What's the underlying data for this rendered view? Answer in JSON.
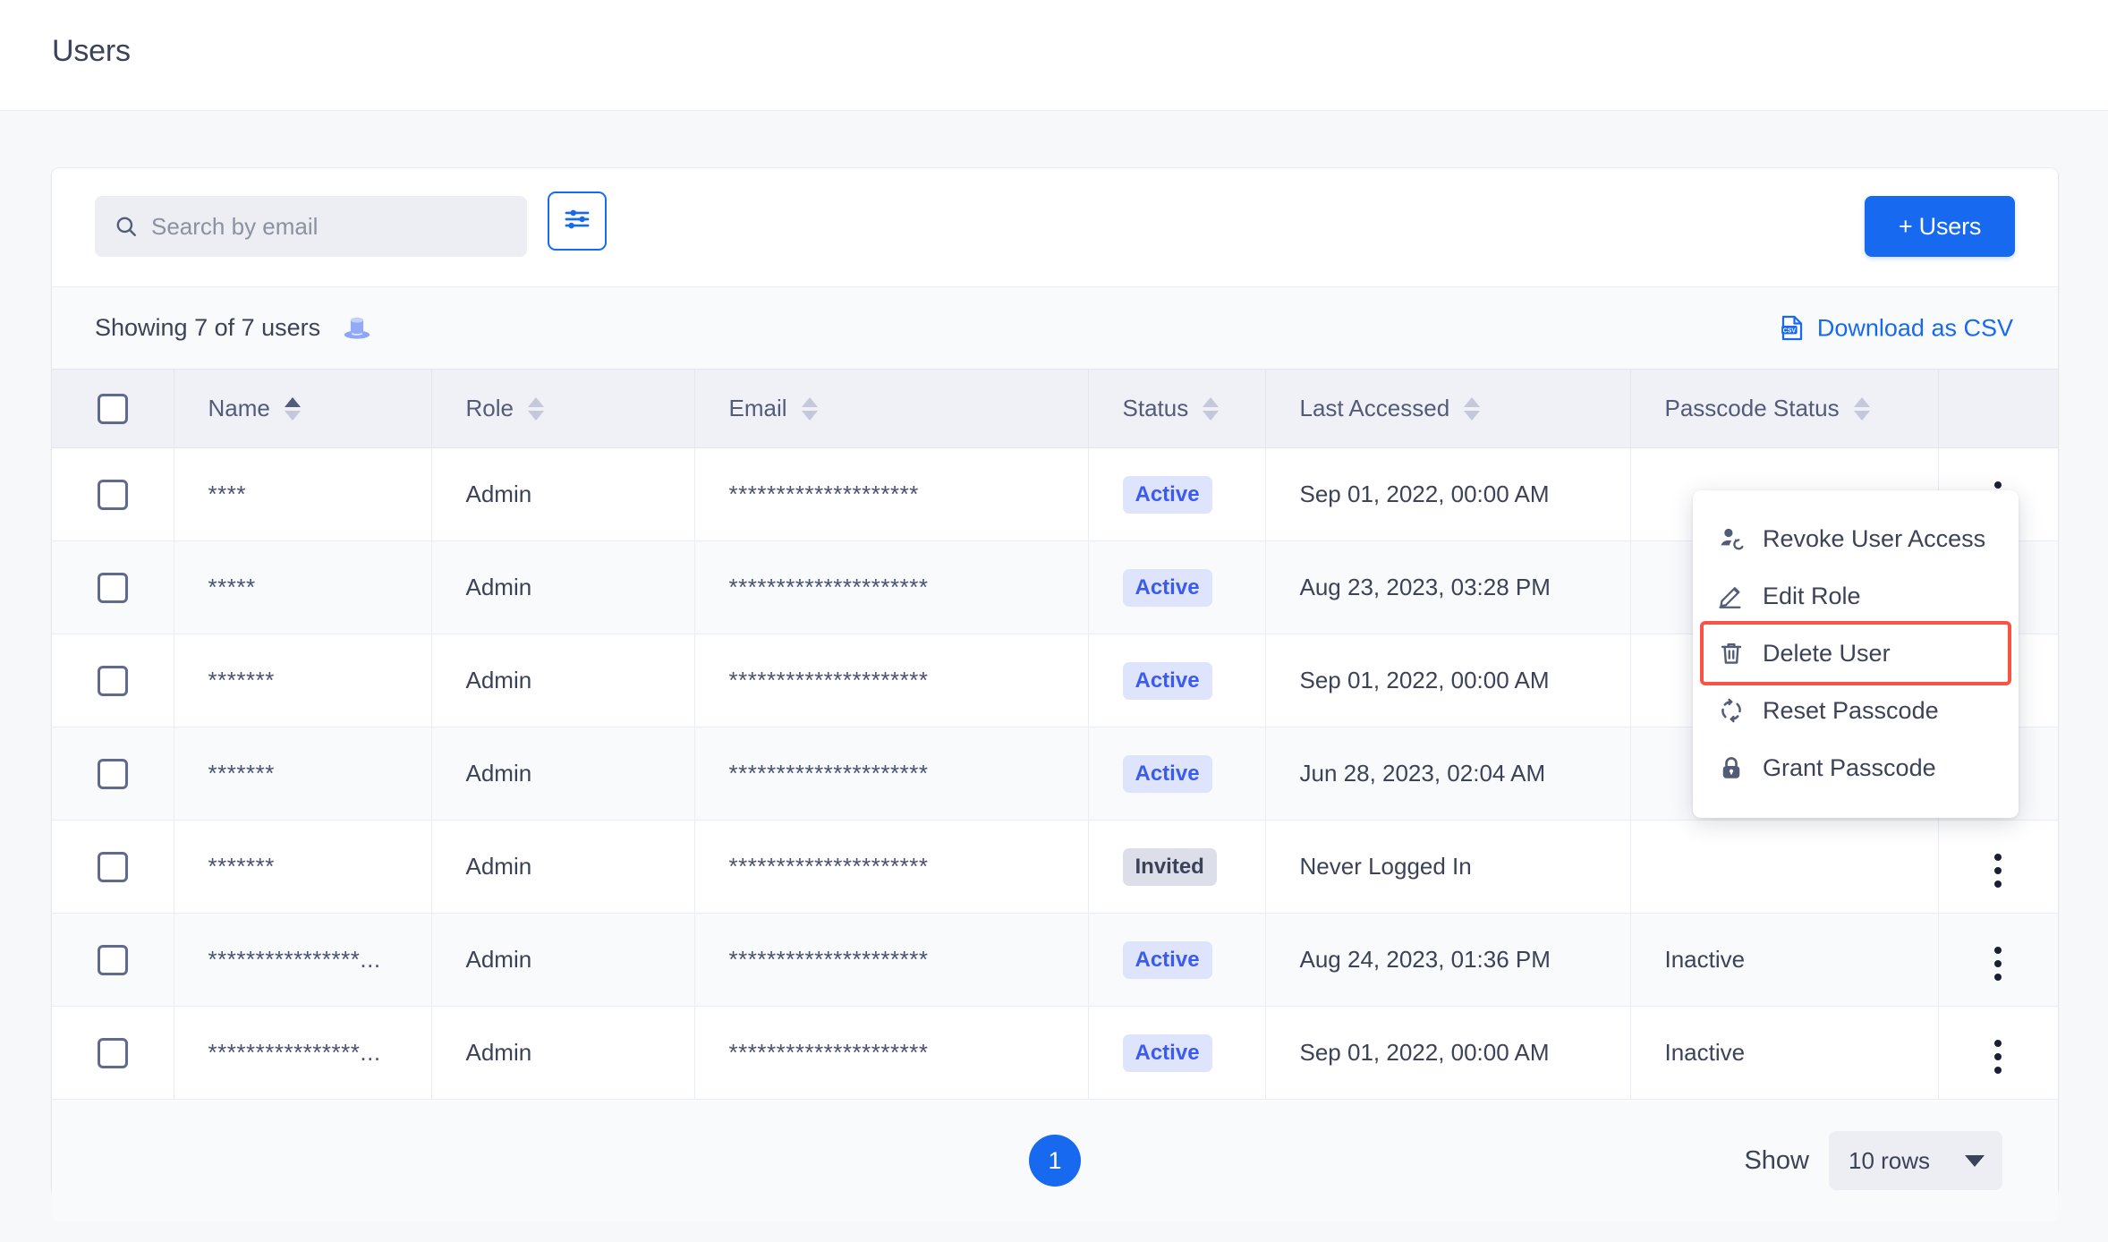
{
  "page": {
    "title": "Users"
  },
  "toolbar": {
    "search_placeholder": "Search by email",
    "search_value": "",
    "filter_icon": "sliders-icon",
    "add_users_label": "+ Users"
  },
  "summary": {
    "text": "Showing 7 of 7 users",
    "hat_icon": "top-hat-icon",
    "csv_label": "Download as CSV",
    "csv_icon": "csv-file-icon"
  },
  "table": {
    "columns": [
      {
        "key": "check",
        "label": ""
      },
      {
        "key": "name",
        "label": "Name",
        "sorted": true
      },
      {
        "key": "role",
        "label": "Role",
        "sorted": false
      },
      {
        "key": "email",
        "label": "Email",
        "sorted": false
      },
      {
        "key": "status",
        "label": "Status",
        "sorted": false
      },
      {
        "key": "last",
        "label": "Last Accessed",
        "sorted": false
      },
      {
        "key": "pass",
        "label": "Passcode Status",
        "sorted": false
      },
      {
        "key": "kebab",
        "label": ""
      }
    ],
    "rows": [
      {
        "name": "****",
        "role": "Admin",
        "email": "********************",
        "status": "Active",
        "status_type": "active",
        "last_accessed": "Sep 01, 2022, 00:00 AM",
        "passcode_status": ""
      },
      {
        "name": "*****",
        "role": "Admin",
        "email": "*********************",
        "status": "Active",
        "status_type": "active",
        "last_accessed": "Aug 23, 2023, 03:28 PM",
        "passcode_status": ""
      },
      {
        "name": "*******",
        "role": "Admin",
        "email": "*********************",
        "status": "Active",
        "status_type": "active",
        "last_accessed": "Sep 01, 2022, 00:00 AM",
        "passcode_status": ""
      },
      {
        "name": "*******",
        "role": "Admin",
        "email": "*********************",
        "status": "Active",
        "status_type": "active",
        "last_accessed": "Jun 28, 2023, 02:04 AM",
        "passcode_status": ""
      },
      {
        "name": "*******",
        "role": "Admin",
        "email": "*********************",
        "status": "Invited",
        "status_type": "invited",
        "last_accessed": "Never Logged In",
        "passcode_status": ""
      },
      {
        "name": "****************...",
        "role": "Admin",
        "email": "*********************",
        "status": "Active",
        "status_type": "active",
        "last_accessed": "Aug 24, 2023, 01:36 PM",
        "passcode_status": "Inactive"
      },
      {
        "name": "****************...",
        "role": "Admin",
        "email": "*********************",
        "status": "Active",
        "status_type": "active",
        "last_accessed": "Sep 01, 2022, 00:00 AM",
        "passcode_status": "Inactive"
      }
    ]
  },
  "footer": {
    "current_page": "1",
    "show_label": "Show",
    "rows_value": "10 rows"
  },
  "context_menu": {
    "items": [
      {
        "label": "Revoke User Access",
        "icon": "user-revoke-icon",
        "highlighted": false
      },
      {
        "label": "Edit Role",
        "icon": "pencil-icon",
        "highlighted": false
      },
      {
        "label": "Delete User",
        "icon": "trash-icon",
        "highlighted": true
      },
      {
        "label": "Reset Passcode",
        "icon": "refresh-icon",
        "highlighted": false
      },
      {
        "label": "Grant Passcode",
        "icon": "lock-icon",
        "highlighted": false
      }
    ]
  },
  "colors": {
    "accent": "#1769f0",
    "highlight": "#fa5243",
    "badge_active_bg": "#dfe4fd",
    "badge_active_fg": "#3a5bf0",
    "badge_invited_bg": "#dcdfe9",
    "text": "#3c4257"
  }
}
